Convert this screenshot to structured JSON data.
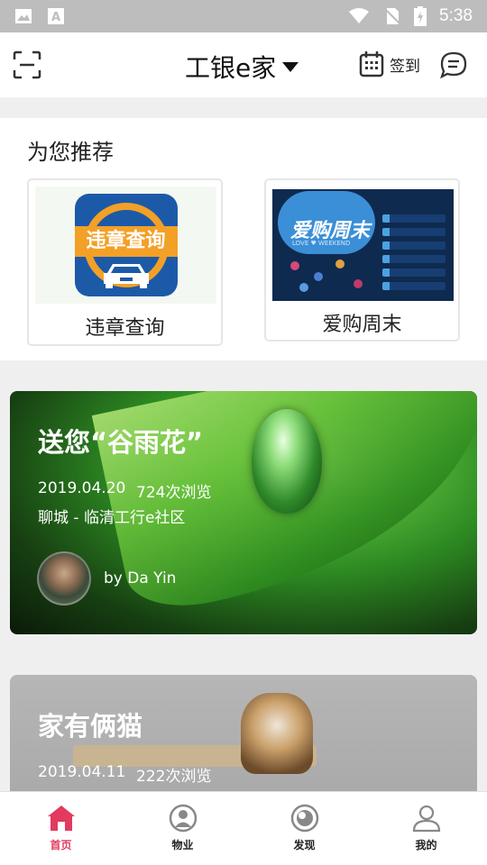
{
  "status_bar": {
    "time": "5:38",
    "icons": [
      "image-icon",
      "font-a-icon",
      "wifi-icon",
      "no-sim-icon",
      "battery-icon"
    ]
  },
  "header": {
    "title": "工银e家",
    "checkin_label": "签到",
    "icons": [
      "scan-icon",
      "dropdown-triangle-icon",
      "calendar-icon",
      "message-icon"
    ]
  },
  "recommend": {
    "title": "为您推荐",
    "items": [
      {
        "label": "违章查询",
        "image_text": "违章查询",
        "icon": "car-icon"
      },
      {
        "label": "爱购周末",
        "image_text": "爱购周末",
        "image_subtext": "LOVE ♥ WEEKEND"
      }
    ]
  },
  "feed": [
    {
      "title": "送您“谷雨花”",
      "date": "2019.04.20",
      "views": "724次浏览",
      "location": "聊城 - 临清工行e社区",
      "author_text": "by  Da Yin"
    },
    {
      "title": "家有俩猫",
      "date": "2019.04.11",
      "views": "222次浏览"
    }
  ],
  "bottom_nav": {
    "active_color": "#e23b5f",
    "items": [
      {
        "label": "首页",
        "icon": "home-icon",
        "active": true
      },
      {
        "label": "物业",
        "icon": "property-icon",
        "active": false
      },
      {
        "label": "发现",
        "icon": "discover-icon",
        "active": false
      },
      {
        "label": "我的",
        "icon": "profile-icon",
        "active": false
      }
    ]
  }
}
